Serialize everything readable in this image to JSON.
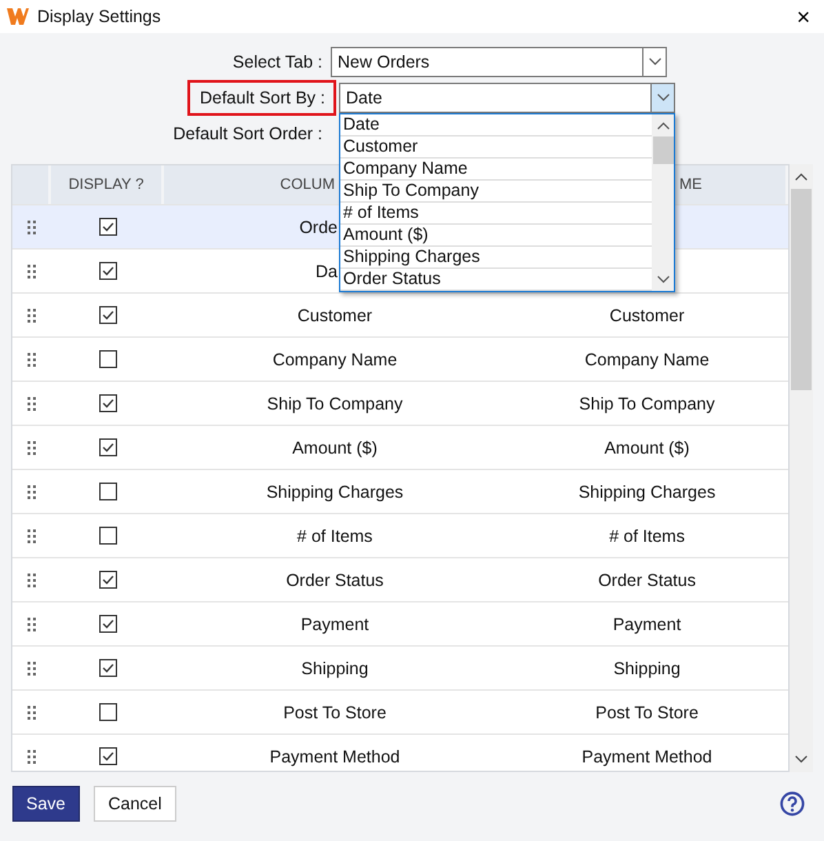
{
  "window": {
    "title": "Display Settings",
    "close": "×"
  },
  "form": {
    "fields": [
      {
        "kind": "select",
        "label": "Select Tab :",
        "value": "New Orders",
        "highlighted": false,
        "open": false
      },
      {
        "kind": "select",
        "label": "Default Sort By :",
        "value": "Date",
        "highlighted": true,
        "open": true,
        "options": [
          "Date",
          "Customer",
          "Company Name",
          "Ship To Company",
          "# of Items",
          "Amount ($)",
          "Shipping Charges",
          "Order Status"
        ]
      },
      {
        "kind": "label",
        "label": "Default Sort Order :",
        "highlighted": false
      }
    ]
  },
  "table": {
    "columns": [
      "DISPLAY ?",
      "COLUM",
      "ME"
    ],
    "rows": [
      {
        "display": true,
        "column": "Orde",
        "selected": true
      },
      {
        "display": true,
        "column": "Da",
        "selected": false
      },
      {
        "display": true,
        "column": "Customer",
        "display_name": "Customer",
        "selected": false
      },
      {
        "display": false,
        "column": "Company Name",
        "display_name": "Company Name",
        "selected": false
      },
      {
        "display": true,
        "column": "Ship To Company",
        "display_name": "Ship To Company",
        "selected": false
      },
      {
        "display": true,
        "column": "Amount ($)",
        "display_name": "Amount ($)",
        "selected": false
      },
      {
        "display": false,
        "column": "Shipping Charges",
        "display_name": "Shipping Charges",
        "selected": false
      },
      {
        "display": false,
        "column": "# of Items",
        "display_name": "# of Items",
        "selected": false
      },
      {
        "display": true,
        "column": "Order Status",
        "display_name": "Order Status",
        "selected": false
      },
      {
        "display": true,
        "column": "Payment",
        "display_name": "Payment",
        "selected": false
      },
      {
        "display": true,
        "column": "Shipping",
        "display_name": "Shipping",
        "selected": false
      },
      {
        "display": false,
        "column": "Post To Store",
        "display_name": "Post To Store",
        "selected": false
      },
      {
        "display": true,
        "column": "Payment Method",
        "display_name": "Payment Method",
        "selected": false
      }
    ]
  },
  "buttons": [
    {
      "kind": "primary",
      "label": "Save"
    },
    {
      "kind": "secondary",
      "label": "Cancel"
    }
  ]
}
